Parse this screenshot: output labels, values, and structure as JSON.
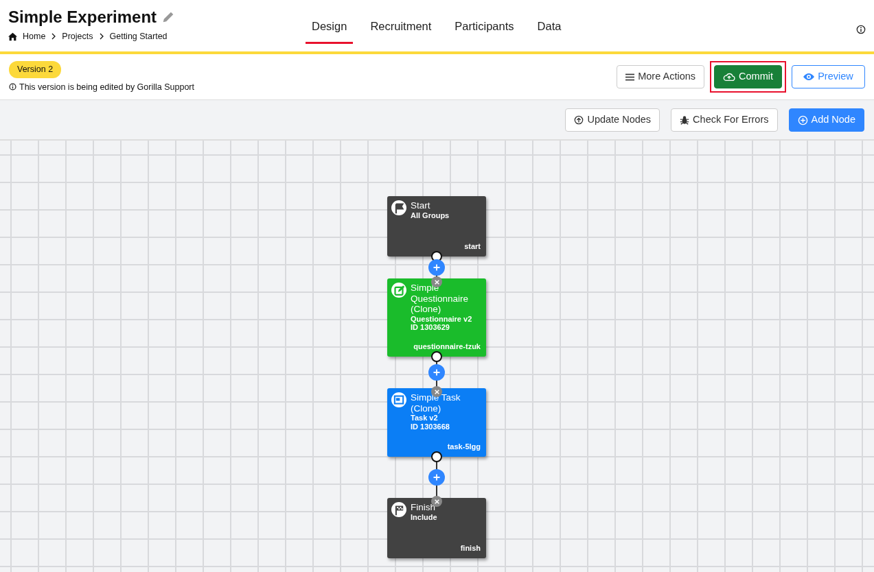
{
  "header": {
    "title": "Simple Experiment",
    "breadcrumb": [
      "Home",
      "Projects",
      "Getting Started"
    ]
  },
  "tabs": [
    {
      "label": "Design",
      "selected": true
    },
    {
      "label": "Recruitment",
      "selected": false
    },
    {
      "label": "Participants",
      "selected": false
    },
    {
      "label": "Data",
      "selected": false
    }
  ],
  "version": {
    "badge": "Version 2",
    "note": "This version is being edited by Gorilla Support"
  },
  "actions": [
    {
      "kind": "menu",
      "label": "More Actions",
      "highlighted": false
    },
    {
      "kind": "commit",
      "label": "Commit",
      "highlighted": true
    },
    {
      "kind": "preview",
      "label": "Preview",
      "highlighted": false
    }
  ],
  "toolbar": [
    {
      "kind": "update",
      "label": "Update Nodes"
    },
    {
      "kind": "check",
      "label": "Check For Errors"
    },
    {
      "kind": "add",
      "label": "Add Node"
    }
  ],
  "nodes": [
    {
      "kind": "start",
      "color": "#424242",
      "title": "Start",
      "subtitle": "All Groups",
      "tag": "start"
    },
    {
      "kind": "questionnaire",
      "color": "#1abc2b",
      "title": "Simple Questionnaire (Clone)",
      "subtitle": "Questionnaire v2",
      "id_text": "ID 1303629",
      "tag": "questionnaire-tzuk"
    },
    {
      "kind": "task",
      "color": "#0b7ef5",
      "title": "Simple Task (Clone)",
      "subtitle": "Task v2",
      "id_text": "ID 1303668",
      "tag": "task-5lgg"
    },
    {
      "kind": "finish",
      "color": "#424242",
      "title": "Finish",
      "subtitle": "Include",
      "tag": "finish"
    }
  ]
}
